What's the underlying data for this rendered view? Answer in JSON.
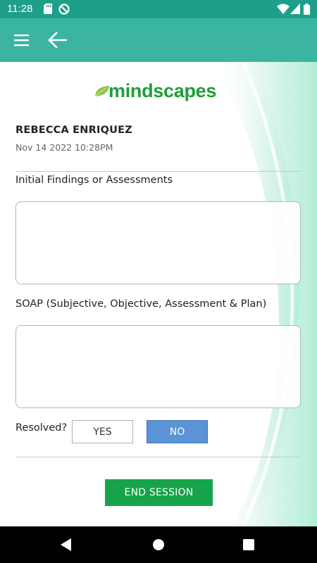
{
  "status_bar": {
    "time": "11:28",
    "icons": [
      "sd-card-icon",
      "data-saver-icon",
      "wifi-icon",
      "signal-icon",
      "battery-icon"
    ]
  },
  "app_bar": {
    "background_color": "#3bb5a2",
    "menu_icon": "hamburger-menu-icon",
    "back_icon": "back-arrow-icon"
  },
  "logo": {
    "text": "mindscapes",
    "color": "#1f9e3a"
  },
  "patient": {
    "name": "REBECCA ENRIQUEZ",
    "datetime": "Nov 14 2022 10:28PM"
  },
  "form": {
    "initial_findings": {
      "label": "Initial Findings or Assessments",
      "value": ""
    },
    "soap": {
      "label": "SOAP (Subjective, Objective, Assessment & Plan)",
      "value": ""
    },
    "resolved": {
      "label": "Resolved?",
      "yes_label": "YES",
      "no_label": "NO",
      "selected": "NO"
    },
    "end_session_label": "END SESSION",
    "end_session_color": "#16a34a",
    "selected_color": "#5b93d6"
  },
  "nav_bar": {
    "icons": [
      "nav-back-icon",
      "nav-home-icon",
      "nav-recents-icon"
    ]
  }
}
